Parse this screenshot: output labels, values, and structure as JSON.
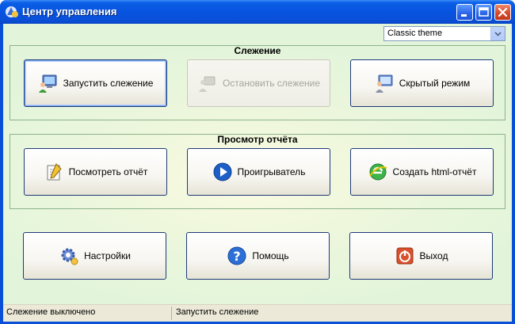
{
  "window": {
    "title": "Центр управления"
  },
  "theme_select": {
    "value": "Classic theme"
  },
  "groups": {
    "monitoring": {
      "title": "Слежение",
      "start_label": "Запустить слежение",
      "stop_label": "Остановить слежение",
      "hidden_label": "Скрытый режим"
    },
    "report": {
      "title": "Просмотр отчёта",
      "view_label": "Посмотреть отчёт",
      "player_label": "Проигрыватель",
      "html_label": "Создать html-отчёт"
    }
  },
  "bottom": {
    "settings_label": "Настройки",
    "help_label": "Помощь",
    "exit_label": "Выход"
  },
  "statusbar": {
    "left": "Слежение выключено",
    "right": "Запустить слежение"
  },
  "icons": {
    "app": "app-icon",
    "start": "monitor-user-icon",
    "stop": "stop-monitoring-icon",
    "hidden": "hidden-mode-icon",
    "view": "report-pencil-icon",
    "player": "play-icon",
    "html": "ie-html-icon",
    "settings": "gear-icon",
    "help": "help-icon",
    "exit": "power-icon"
  }
}
